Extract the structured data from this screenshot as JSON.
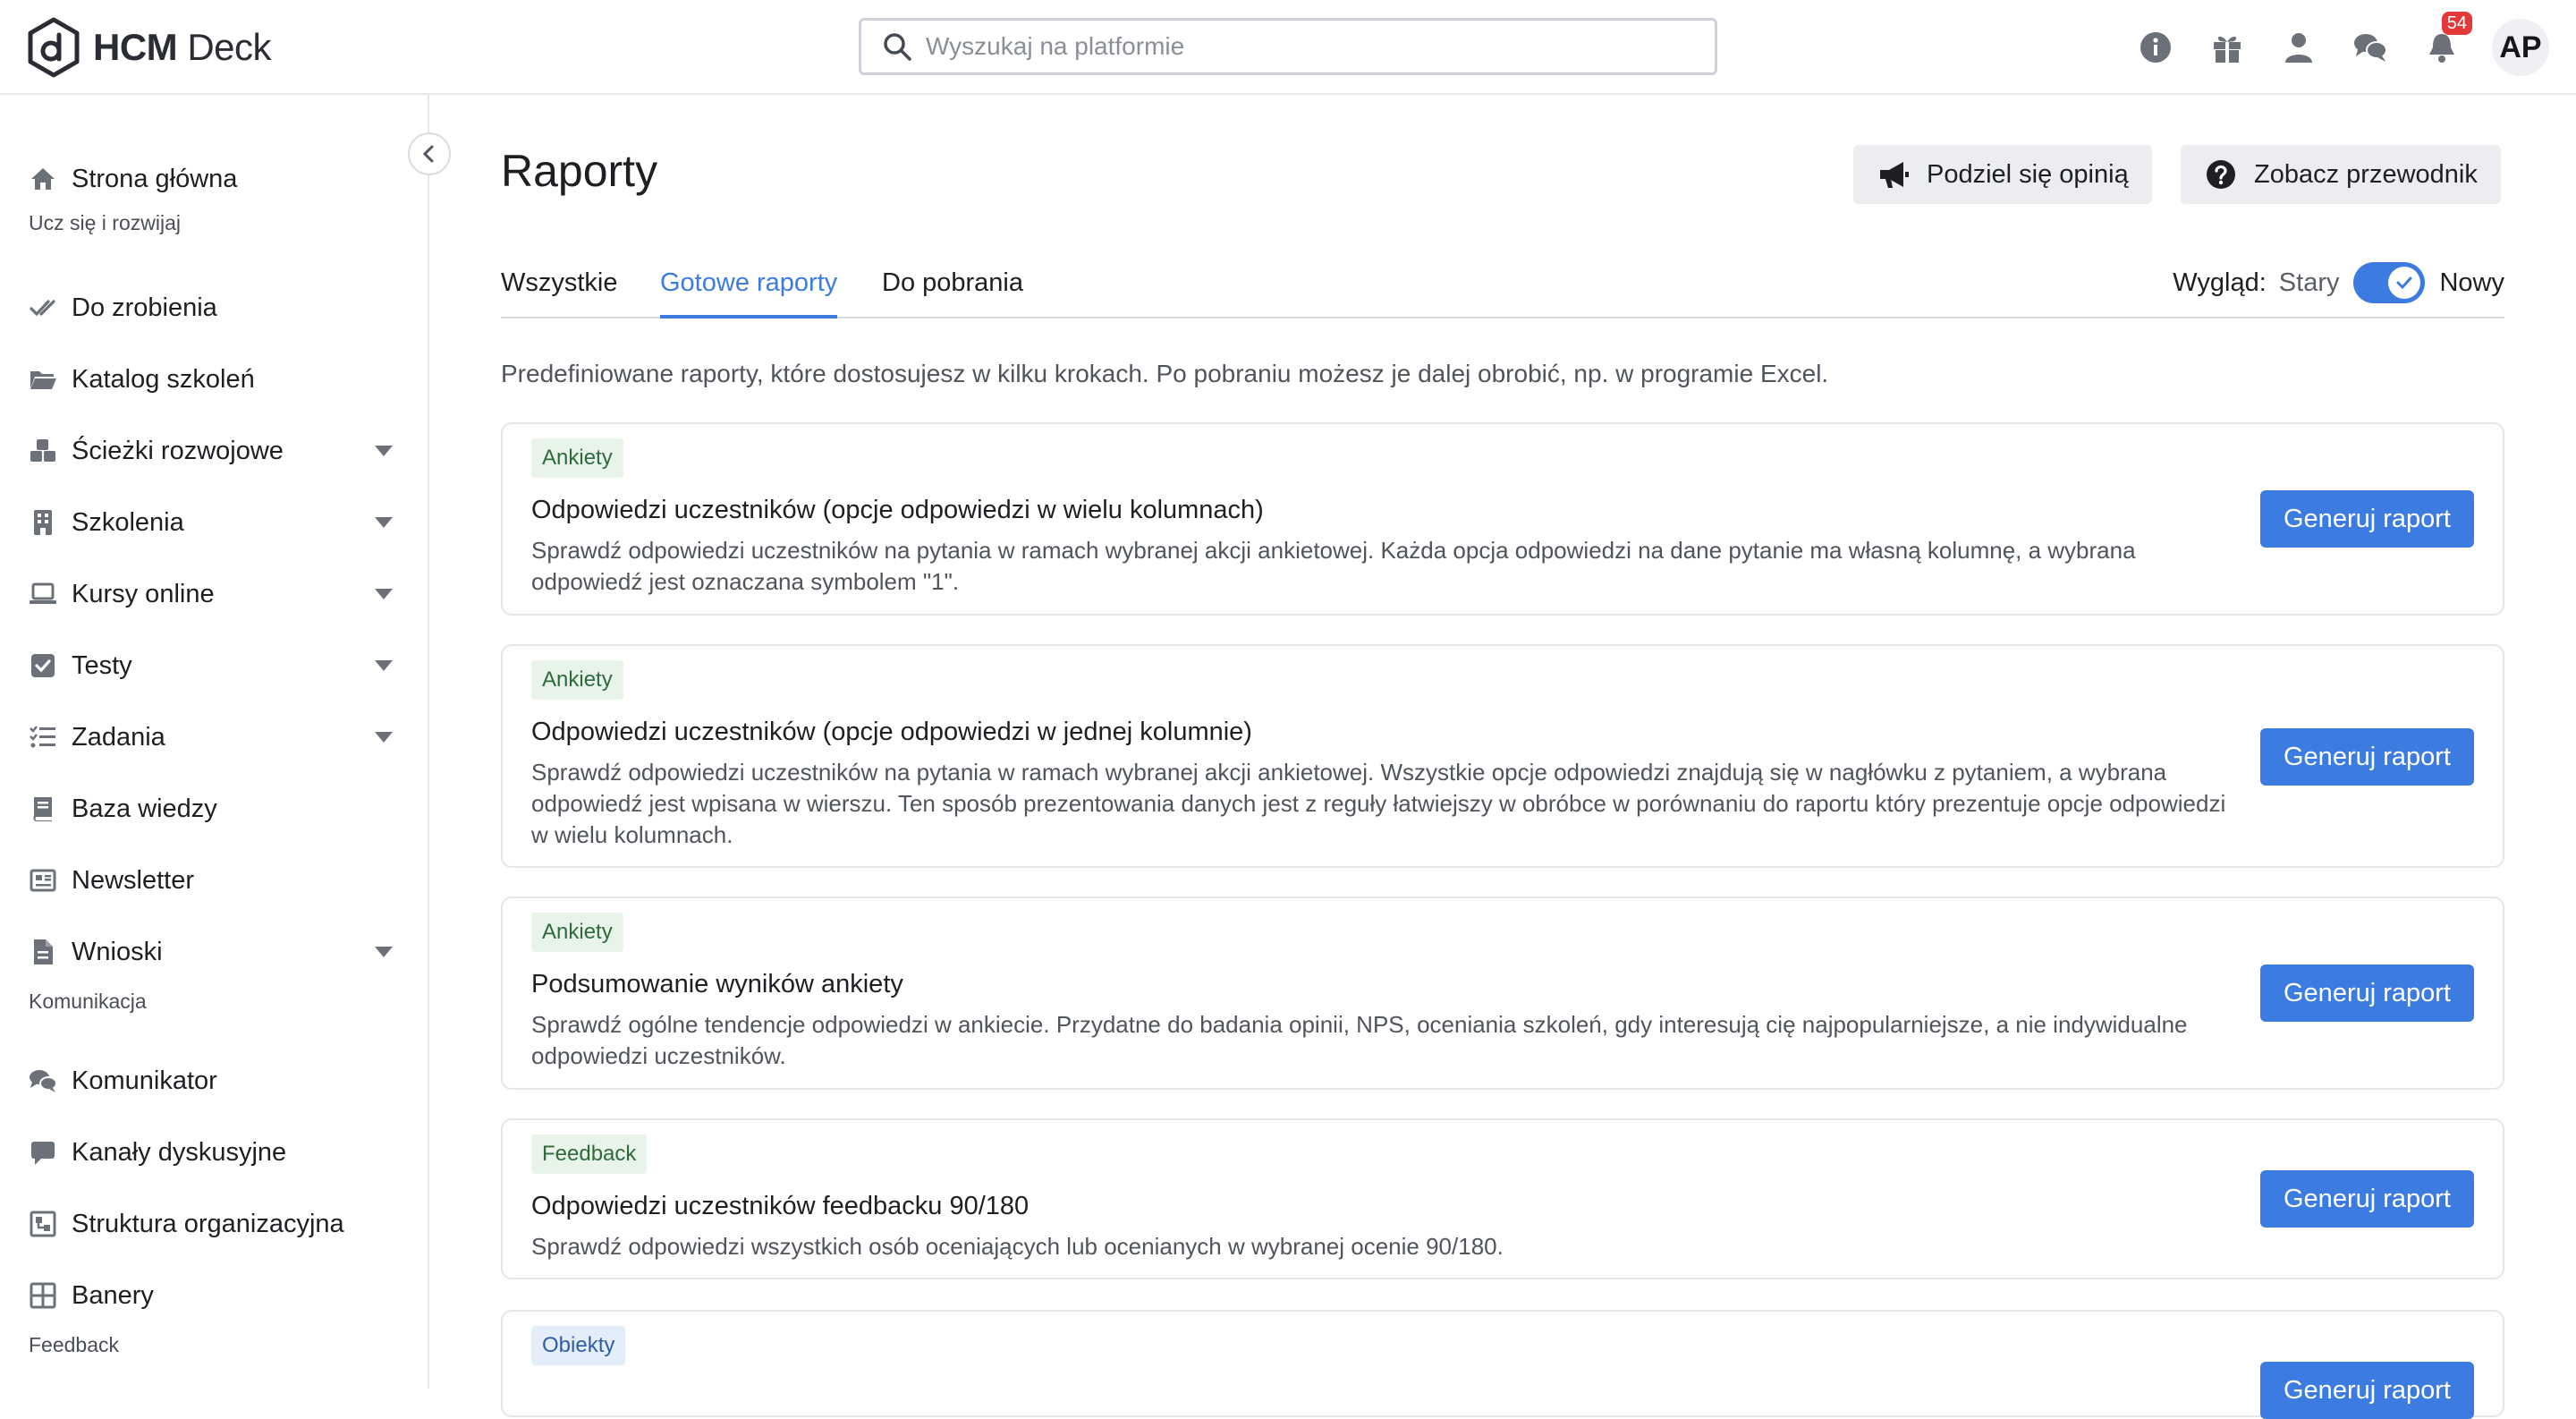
{
  "app": {
    "logo_bold": "HCM",
    "logo_light": "Deck"
  },
  "search": {
    "placeholder": "Wyszukaj na platformie",
    "value": ""
  },
  "topbar": {
    "icons": [
      "info-icon",
      "gift-icon",
      "user-icon",
      "chat-icon",
      "bell-icon"
    ],
    "notification_count": "54",
    "avatar_initials": "AP"
  },
  "sidebar": {
    "home": "Strona główna",
    "section_learn": "Ucz się i rozwijaj",
    "items_learn": [
      {
        "label": "Do zrobienia",
        "icon": "check-icon",
        "expandable": false
      },
      {
        "label": "Katalog szkoleń",
        "icon": "folder-icon",
        "expandable": false
      },
      {
        "label": "Ścieżki rozwojowe",
        "icon": "cubes-icon",
        "expandable": true
      },
      {
        "label": "Szkolenia",
        "icon": "building-icon",
        "expandable": true
      },
      {
        "label": "Kursy online",
        "icon": "laptop-icon",
        "expandable": true
      },
      {
        "label": "Testy",
        "icon": "check-square-icon",
        "expandable": true
      },
      {
        "label": "Zadania",
        "icon": "task-list-icon",
        "expandable": true
      },
      {
        "label": "Baza wiedzy",
        "icon": "book-icon",
        "expandable": false
      },
      {
        "label": "Newsletter",
        "icon": "newspaper-icon",
        "expandable": false
      },
      {
        "label": "Wnioski",
        "icon": "file-icon",
        "expandable": true
      }
    ],
    "section_comm": "Komunikacja",
    "items_comm": [
      {
        "label": "Komunikator",
        "icon": "comments-icon"
      },
      {
        "label": "Kanały dyskusyjne",
        "icon": "comment-icon"
      },
      {
        "label": "Struktura organizacyjna",
        "icon": "org-chart-icon"
      },
      {
        "label": "Banery",
        "icon": "grid-icon"
      }
    ],
    "section_feedback": "Feedback"
  },
  "main": {
    "title": "Raporty",
    "share_button": "Podziel się opinią",
    "guide_button": "Zobacz przewodnik",
    "tabs": [
      {
        "label": "Wszystkie",
        "active": false
      },
      {
        "label": "Gotowe raporty",
        "active": true
      },
      {
        "label": "Do pobrania",
        "active": false
      }
    ],
    "view_label": "Wygląd:",
    "view_old": "Stary",
    "view_new": "Nowy",
    "view_new_enabled": true,
    "description": "Predefiniowane raporty, które dostosujesz w kilku krokach. Po pobraniu możesz je dalej obrobić, np. w programie Excel.",
    "generate_label": "Generuj raport",
    "reports": [
      {
        "tag": "Ankiety",
        "title": "Odpowiedzi uczestników (opcje odpowiedzi w wielu kolumnach)",
        "description": "Sprawdź odpowiedzi uczestników na pytania w ramach wybranej akcji ankietowej. Każda opcja odpowiedzi na dane pytanie ma własną kolumnę, a wybrana odpowiedź jest oznaczana symbolem \"1\"."
      },
      {
        "tag": "Ankiety",
        "title": "Odpowiedzi uczestników (opcje odpowiedzi w jednej kolumnie)",
        "description": "Sprawdź odpowiedzi uczestników na pytania w ramach wybranej akcji ankietowej. Wszystkie opcje odpowiedzi znajdują się w nagłówku z pytaniem, a wybrana odpowiedź jest wpisana w wierszu. Ten sposób prezentowania danych jest z reguły łatwiejszy w obróbce w porównaniu do raportu który prezentuje opcje odpowiedzi w wielu kolumnach."
      },
      {
        "tag": "Ankiety",
        "title": "Podsumowanie wyników ankiety",
        "description": "Sprawdź ogólne tendencje odpowiedzi w ankiecie. Przydatne do badania opinii, NPS, oceniania szkoleń, gdy interesują cię najpopularniejsze, a nie indywidualne odpowiedzi uczestników."
      },
      {
        "tag": "Feedback",
        "title": "Odpowiedzi uczestników feedbacku 90/180",
        "description": "Sprawdź odpowiedzi wszystkich osób oceniających lub ocenianych w wybranej ocenie 90/180."
      },
      {
        "tag": "Obiekty",
        "title": "",
        "description": ""
      }
    ]
  },
  "colors": {
    "accent": "#3c7ce0",
    "tag_green_bg": "#e8f3ea",
    "tag_blue_bg": "#e4eefb",
    "badge": "#e23a3a"
  }
}
